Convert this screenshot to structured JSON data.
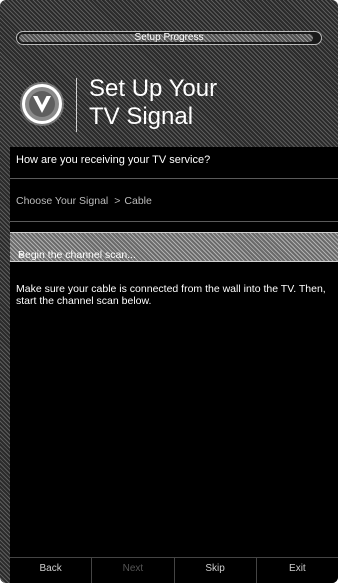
{
  "header": {
    "progress_label": "Setup Progress",
    "progress_fraction": 0.98
  },
  "brand": {
    "logo_icon": "vizio-v-logo-icon"
  },
  "title": {
    "line1": "Set Up Your",
    "line2": "TV Signal"
  },
  "question": "How are you receiving your TV service?",
  "breadcrumb": {
    "label": "Choose Your Signal",
    "separator": ">",
    "selected": "Cable"
  },
  "scan_item": {
    "separator": ">",
    "label": "Begin the channel scan..."
  },
  "info_text": "Make sure your cable is connected from the wall into the TV. Then, start the channel scan below.",
  "footer": {
    "buttons": [
      {
        "label": "Back",
        "enabled": true
      },
      {
        "label": "Next",
        "enabled": false
      },
      {
        "label": "Skip",
        "enabled": true
      },
      {
        "label": "Exit",
        "enabled": true
      }
    ]
  }
}
